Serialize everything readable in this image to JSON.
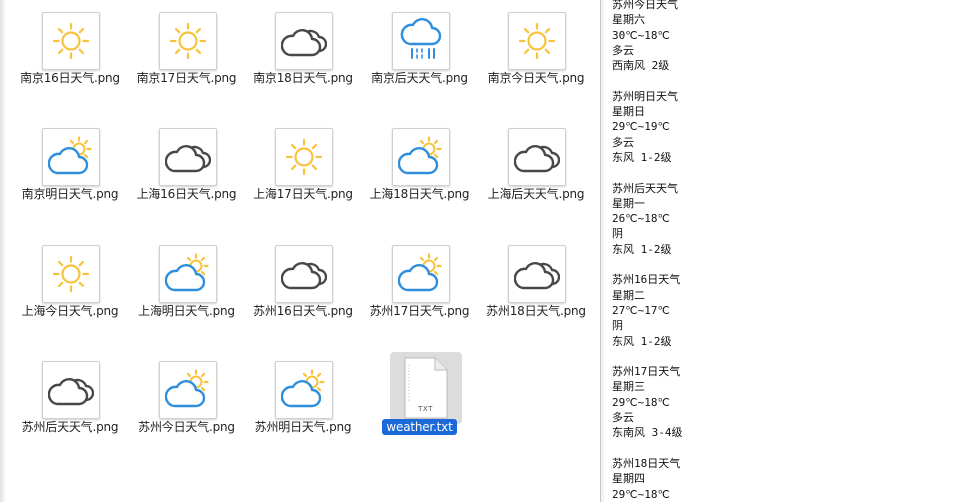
{
  "files": [
    {
      "name": "南京16日天气.png",
      "icon": "sun"
    },
    {
      "name": "南京17日天气.png",
      "icon": "sun"
    },
    {
      "name": "南京18日天气.png",
      "icon": "cloud"
    },
    {
      "name": "南京后天天气.png",
      "icon": "rain"
    },
    {
      "name": "南京今日天气.png",
      "icon": "sun"
    },
    {
      "name": "南京明日天气.png",
      "icon": "partly"
    },
    {
      "name": "上海16日天气.png",
      "icon": "cloud"
    },
    {
      "name": "上海17日天气.png",
      "icon": "sun"
    },
    {
      "name": "上海18日天气.png",
      "icon": "partly"
    },
    {
      "name": "上海后天天气.png",
      "icon": "cloud"
    },
    {
      "name": "上海今日天气.png",
      "icon": "sun"
    },
    {
      "name": "上海明日天气.png",
      "icon": "partly"
    },
    {
      "name": "苏州16日天气.png",
      "icon": "cloud"
    },
    {
      "name": "苏州17日天气.png",
      "icon": "partly"
    },
    {
      "name": "苏州18日天气.png",
      "icon": "cloud"
    },
    {
      "name": "苏州后天天气.png",
      "icon": "cloud"
    },
    {
      "name": "苏州今日天气.png",
      "icon": "partly"
    },
    {
      "name": "苏州明日天气.png",
      "icon": "partly"
    },
    {
      "name": "weather.txt",
      "icon": "txt",
      "selected": true,
      "badge": "TXT"
    }
  ],
  "text_content": "苏州今日天气\n星期六\n30℃~18℃\n多云\n西南风 2级\n\n苏州明日天气\n星期日\n29℃~19℃\n多云\n东风 1-2级\n\n苏州后天天气\n星期一\n26℃~18℃\n阴\n东风 1-2级\n\n苏州16日天气\n星期二\n27℃~17℃\n阴\n东风 1-2级\n\n苏州17日天气\n星期三\n29℃~18℃\n多云\n东南风 3-4级\n\n苏州18日天气\n星期四\n29℃~18℃",
  "colors": {
    "sun": "#f8c33c",
    "cloud_dark": "#484848",
    "cloud_blue": "#2f8fdc",
    "selection": "#1b6ad8"
  }
}
